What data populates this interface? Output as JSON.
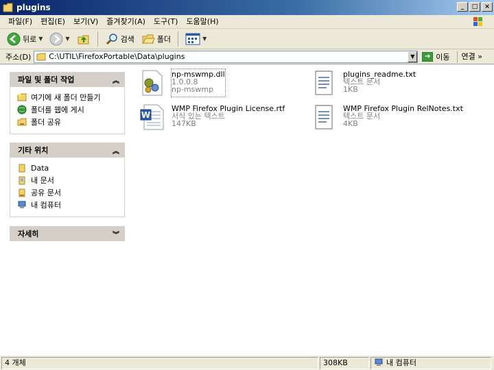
{
  "window": {
    "title": "plugins"
  },
  "title_controls": [
    "_",
    "□",
    "×"
  ],
  "menu": [
    "파일(F)",
    "편집(E)",
    "보기(V)",
    "즐겨찾기(A)",
    "도구(T)",
    "도움말(H)"
  ],
  "toolbar": {
    "back_label": "뒤로",
    "search_label": "검색",
    "folders_label": "폴더"
  },
  "address": {
    "label": "주소(D)",
    "path": "C:\\UTIL\\FirefoxPortable\\Data\\plugins",
    "go_label": "이동",
    "links_label": "연결 »"
  },
  "panels": {
    "file_tasks": {
      "title": "파일 및 폴더 작업",
      "items": [
        "여기에 새 폴더 만들기",
        "폴더를 웹에 게시",
        "폴더 공유"
      ]
    },
    "other_places": {
      "title": "기타 위치",
      "items": [
        "Data",
        "내 문서",
        "공유 문서",
        "내 컴퓨터"
      ]
    },
    "details": {
      "title": "자세히"
    }
  },
  "files": [
    {
      "name": "np-mswmp.dll",
      "line2": "1.0.0.8",
      "line3": "np-mswmp"
    },
    {
      "name": "plugins_readme.txt",
      "line2": "텍스트 문서",
      "line3": "1KB"
    },
    {
      "name": "WMP Firefox Plugin License.rtf",
      "line2": "서식 있는 텍스트",
      "line3": "147KB"
    },
    {
      "name": "WMP Firefox Plugin RelNotes.txt",
      "line2": "텍스트 문서",
      "line3": "4KB"
    }
  ],
  "status": {
    "count": "4 개체",
    "size": "308KB",
    "location": "내 컴퓨터"
  }
}
